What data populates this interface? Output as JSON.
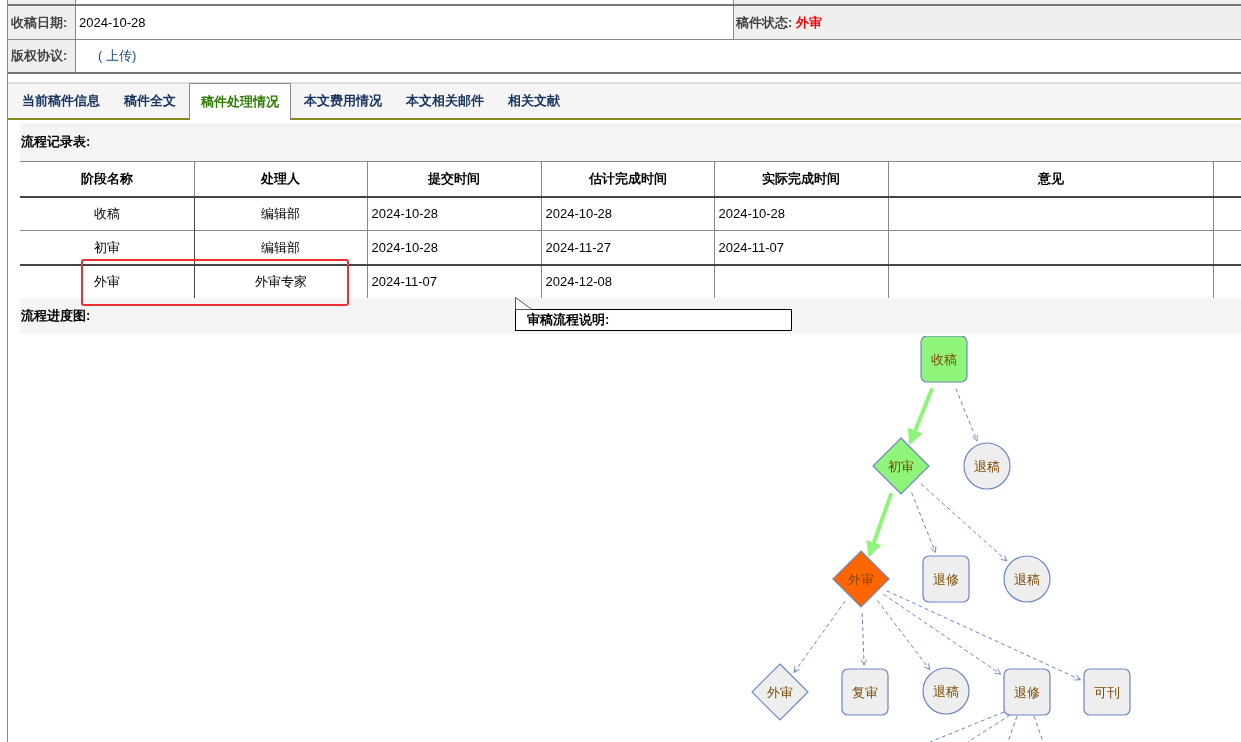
{
  "info_rows": [
    {
      "label": "收稿日期:",
      "value": "2024-10-28",
      "status_label": "稿件状态:",
      "status_value": "外审"
    },
    {
      "label": "版权协议:",
      "link": "( 上传)"
    }
  ],
  "tabs": [
    {
      "label": "当前稿件信息",
      "selected": false
    },
    {
      "label": "稿件全文",
      "selected": false
    },
    {
      "label": "稿件处理情况",
      "selected": true
    },
    {
      "label": "本文费用情况",
      "selected": false
    },
    {
      "label": "本文相关邮件",
      "selected": false
    },
    {
      "label": "相关文献",
      "selected": false
    }
  ],
  "record_title": "流程记录表:",
  "table": {
    "columns": [
      "阶段名称",
      "处理人",
      "提交时间",
      "估计完成时间",
      "实际完成时间",
      "意见"
    ],
    "rows": [
      [
        "收稿",
        "编辑部",
        "2024-10-28",
        "2024-10-28",
        "2024-10-28",
        ""
      ],
      [
        "初审",
        "编辑部",
        "2024-10-28",
        "2024-11-27",
        "2024-11-07",
        ""
      ],
      [
        "外审",
        "外审专家",
        "2024-11-07",
        "2024-12-08",
        "",
        ""
      ]
    ]
  },
  "progress_title": "流程进度图:",
  "tooltip": "审稿流程说明:",
  "flow": {
    "root": {
      "label": "收稿",
      "kind": "rect",
      "done": true,
      "current": false,
      "children": [
        {
          "label": "初审",
          "kind": "diamond",
          "done": true,
          "current": false,
          "children": [
            {
              "label": "外审",
              "kind": "diamond",
              "done": false,
              "current": true,
              "children": [
                {
                  "label": "外审",
                  "kind": "diamond",
                  "done": false,
                  "current": false
                },
                {
                  "label": "复审",
                  "kind": "rect",
                  "done": false,
                  "current": false
                },
                {
                  "label": "退稿",
                  "kind": "circle",
                  "done": false,
                  "current": false
                },
                {
                  "label": "退修",
                  "kind": "rect",
                  "done": false,
                  "current": false
                },
                {
                  "label": "可刊",
                  "kind": "rect",
                  "done": false,
                  "current": false
                }
              ]
            },
            {
              "label": "退修",
              "kind": "rect",
              "done": false,
              "current": false
            },
            {
              "label": "退稿",
              "kind": "circle",
              "done": false,
              "current": false
            }
          ]
        },
        {
          "label": "退稿",
          "kind": "circle",
          "done": false,
          "current": false
        }
      ]
    }
  }
}
